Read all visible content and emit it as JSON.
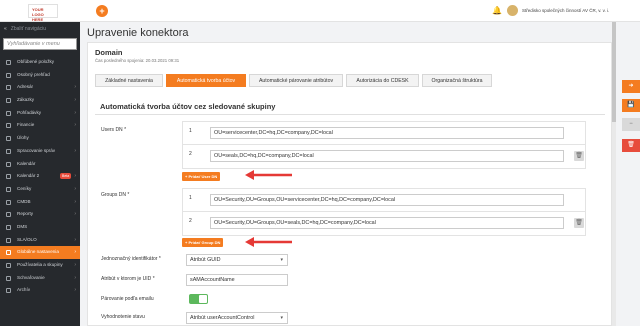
{
  "header": {
    "logo_text": "YOUR LOGO HERE",
    "add_label": "+",
    "user_name": "Středisko společných činností AV ČR, v. v. i."
  },
  "sidebar": {
    "collapse_label": "Zbaliť navigáciu",
    "search_placeholder": "Vyhľadávanie v menu",
    "items": [
      {
        "label": "Obľúbené položky",
        "chevron": ""
      },
      {
        "label": "Osobný prehľad",
        "chevron": ""
      },
      {
        "label": "Adresár",
        "chevron": "›"
      },
      {
        "label": "Zákazky",
        "chevron": "›"
      },
      {
        "label": "Pohľadávky",
        "chevron": "›"
      },
      {
        "label": "Financie",
        "chevron": "›"
      },
      {
        "label": "Úlohy",
        "chevron": ""
      },
      {
        "label": "Spracovanie správ",
        "chevron": "›"
      },
      {
        "label": "Kalendár",
        "chevron": ""
      },
      {
        "label": "Kalendár 2",
        "chevron": "›",
        "badge": "Beta"
      },
      {
        "label": "Ceníky",
        "chevron": "›"
      },
      {
        "label": "CMDB",
        "chevron": "›"
      },
      {
        "label": "Reporty",
        "chevron": "›"
      },
      {
        "label": "DMS",
        "chevron": ""
      },
      {
        "label": "SLA/OLO",
        "chevron": "›"
      },
      {
        "label": "Globálne nastavenia",
        "chevron": "›",
        "active": true
      },
      {
        "label": "Používatelia a skupiny",
        "chevron": "›"
      },
      {
        "label": "Schvaľovanie",
        "chevron": "›"
      },
      {
        "label": "Archív",
        "chevron": "›"
      }
    ]
  },
  "page": {
    "title": "Upravenie konektora"
  },
  "card": {
    "title": "Domain",
    "subtitle": "Čas posledného spojenia: 20.03.2021 09:31"
  },
  "tabs": [
    {
      "label": "Základné nastavenia",
      "active": false
    },
    {
      "label": "Automatická tvorba účtov",
      "active": true
    },
    {
      "label": "Automatické párovanie atribútov",
      "active": false
    },
    {
      "label": "Autorizácia do CDESK",
      "active": false
    },
    {
      "label": "Organizačná štruktúra",
      "active": false
    }
  ],
  "section": {
    "title": "Automatická tvorba účtov cez sledované skupiny"
  },
  "users_dn": {
    "label": "Users DN",
    "required": "*",
    "rows": [
      {
        "num": "1",
        "value": "OU=servicecenter,DC=hq,DC=company,DC=local"
      },
      {
        "num": "2",
        "value": "OU=seals,DC=hq,DC=company,DC=local"
      }
    ],
    "add_label": "+ Pridať User DN"
  },
  "groups_dn": {
    "label": "Groups DN",
    "required": "*",
    "rows": [
      {
        "num": "1",
        "value": "OU=Security,OU=Groups,OU=servicecenter,DC=hq,DC=company,DC=local"
      },
      {
        "num": "2",
        "value": "OU=Security,OU=Groups,OU=seals,DC=hq,DC=company,DC=local"
      }
    ],
    "add_label": "+ Pridať Group DN"
  },
  "form": {
    "unique_id_label": "Jednoznačný identifikátor",
    "unique_id_value": "Atribút GUID",
    "uid_attr_label": "Atribút v ktorom je UID",
    "uid_attr_value": "sAMAccountName",
    "email_pair_label": "Párovanie podľa emailu",
    "email_pair_on": true,
    "status_eval_label": "Vyhodnotenie stavu",
    "status_eval_value": "Atribút userAccountControl",
    "required_mark": "*"
  },
  "colors": {
    "accent": "#f47c20",
    "sidebar_bg": "#26292d",
    "toggle_on": "#5cb85c",
    "arrow": "#e53935"
  }
}
